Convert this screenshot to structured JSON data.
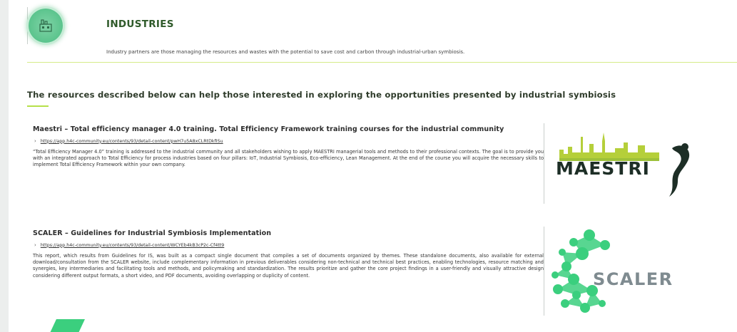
{
  "header": {
    "title": "INDUSTRIES",
    "icon": "factory-icon",
    "description": "Industry partners are those managing the resources and wastes with the potential to save cost and carbon through industrial-urban symbiosis."
  },
  "intro": "The resources described below can help those interested in exploring the opportunities presented by industrial symbiosis",
  "resources": [
    {
      "title": "Maestri – Total efficiency manager 4.0 training. Total Efficiency Framework training courses for the industrial community",
      "link": "https://app.h4c-community.eu/contents/93/detail-content/pwH7u5A8xCLRtDkfISu",
      "body": "“Total Efficiency Manager 4.0” training is addressed to the industrial community and all stakeholders wishing to apply MAESTRI managerial tools and methods to their professional contexts. The goal is to provide you with an integrated approach to Total Efficiency for process industries based on four pillars: IoT, Industrial Symbiosis, Eco-efficiency, Lean Management. At the end of the course you will acquire the necessary skills to implement Total Efficiency Framework within your own company.",
      "logo_text": "MAESTRI"
    },
    {
      "title": "SCALER – Guidelines for Industrial Symbiosis Implementation",
      "link": "https://app.h4c-community.eu/contents/93/detail-content/WCYEb4kB3cP2c-Cf4tt9",
      "body": "This report, which results from Guidelines for IS, was built as a compact single document that compiles a set of documents organized by themes. These standalone documents, also available for external download/consultation from the SCALER website, include complementary information in previous deliverables considering non-technical and technical best practices, enabling technologies, resource matching and synergies, key intermediaries and facilitating tools and methods, and policymaking and standardization. The results prioritize and gather the core project findings in a user-friendly and visually attractive design considering different output formats, a short video, and PDF documents, avoiding overlapping or duplicity of content.",
      "logo_text": "SCALER"
    }
  ],
  "colors": {
    "accent": "#b6e04a",
    "title_green": "#2f5a2a",
    "icon_green": "#5bc48d",
    "scaler_green": "#3bcf7e",
    "maestri_lime": "#b5cf3a"
  }
}
